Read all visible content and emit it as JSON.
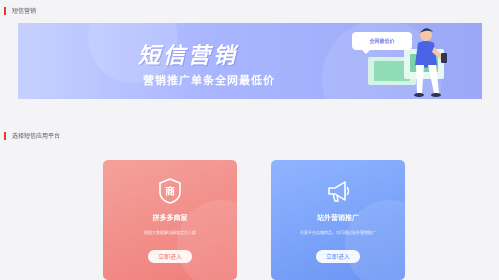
{
  "sections": {
    "sms_marketing": "短信营销",
    "choose_platform": "选择短信应用平台"
  },
  "banner": {
    "title": "短信营销",
    "subtitle": "营销推广单条全网最低价",
    "bubble": "全网最低价"
  },
  "cards": [
    {
      "title": "拼多多商家",
      "description": "根据大数据算法精准定位人群",
      "button": "立即进入",
      "icon": "store-shield-icon",
      "accent": "#f07e7a"
    },
    {
      "title": "站外营销推广",
      "description": "任意平台店铺商品，均可通过站外营销推广",
      "button": "立即进入",
      "icon": "megaphone-icon",
      "accent": "#6b95f4"
    }
  ],
  "colors": {
    "section_bar": "#e53935",
    "banner": "#a9b6ff"
  }
}
